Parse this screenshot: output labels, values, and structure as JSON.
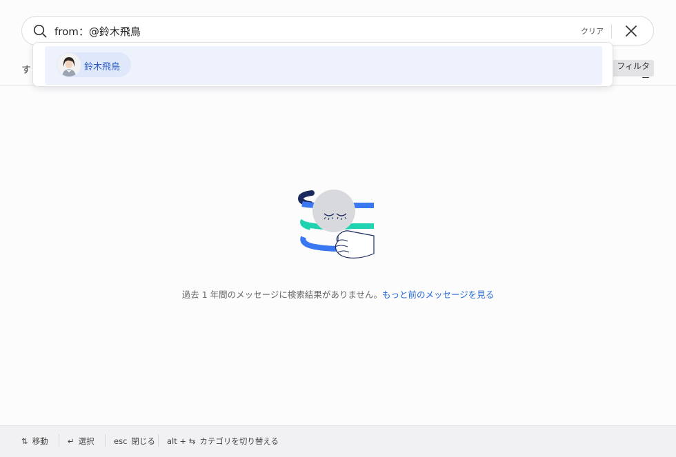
{
  "search": {
    "value": "from：@鈴木飛鳥",
    "clear_label": "クリア"
  },
  "tabs": {
    "first_partial": "す"
  },
  "filter_label": "フィルター",
  "suggestions": [
    {
      "name": "鈴木飛鳥"
    }
  ],
  "empty": {
    "message": "過去 1 年間のメッセージに検索結果がありません。",
    "link": "もっと前のメッセージを見る"
  },
  "footer": {
    "hints": [
      {
        "key": "⇅",
        "label": "移動"
      },
      {
        "key": "↵",
        "label": "選択"
      },
      {
        "key": "esc",
        "label": "閉じる"
      },
      {
        "key": "alt + ⇆",
        "label": "カテゴリを切り替える"
      }
    ]
  },
  "colors": {
    "accent": "#2468d4",
    "chip_bg": "#dfe8fb",
    "row_bg": "#edf2fd",
    "illus_blue": "#3a78f2",
    "illus_teal": "#1fd3b0",
    "illus_navy": "#1a2a5e"
  }
}
